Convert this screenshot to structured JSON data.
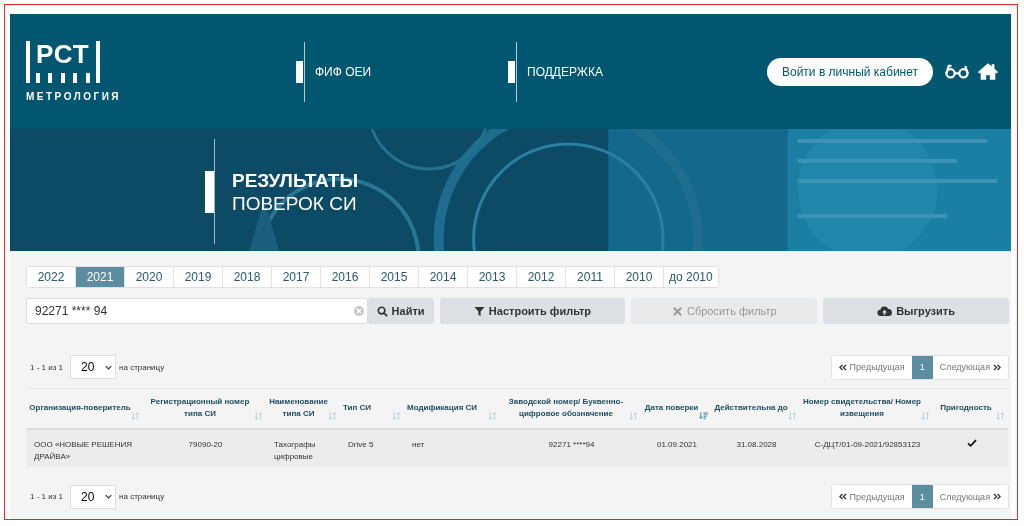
{
  "header": {
    "logo": {
      "mark": "РСТ",
      "subtitle": "МЕТРОЛОГИЯ"
    },
    "nav": [
      {
        "label": "ФИФ ОЕИ"
      },
      {
        "label": "ПОДДЕРЖКА"
      }
    ],
    "login_button": "Войти в личный кабинет"
  },
  "banner": {
    "title_bold": "РЕЗУЛЬТАТЫ",
    "title_light": "ПОВЕРОК СИ"
  },
  "year_tabs": [
    {
      "label": "2022",
      "selected": false
    },
    {
      "label": "2021",
      "selected": true
    },
    {
      "label": "2020",
      "selected": false
    },
    {
      "label": "2019",
      "selected": false
    },
    {
      "label": "2018",
      "selected": false
    },
    {
      "label": "2017",
      "selected": false
    },
    {
      "label": "2016",
      "selected": false
    },
    {
      "label": "2015",
      "selected": false
    },
    {
      "label": "2014",
      "selected": false
    },
    {
      "label": "2013",
      "selected": false
    },
    {
      "label": "2012",
      "selected": false
    },
    {
      "label": "2011",
      "selected": false
    },
    {
      "label": "2010",
      "selected": false
    },
    {
      "label": "до 2010",
      "selected": false
    }
  ],
  "search": {
    "value": "92271 **** 94"
  },
  "actions": [
    {
      "kind": "search",
      "label": "Найти",
      "disabled": false
    },
    {
      "kind": "filter",
      "label": "Настроить фильтр",
      "disabled": false
    },
    {
      "kind": "reset",
      "label": "Сбросить фильтр",
      "disabled": true
    },
    {
      "kind": "export",
      "label": "Выгрузить",
      "disabled": false
    }
  ],
  "pagination_top": {
    "info": "1 - 1 из 1",
    "page_size": "20",
    "page_size_label": "на страницу",
    "prev": "Предыдущая",
    "pages": [
      {
        "label": "1",
        "selected": true
      }
    ],
    "next": "Следующая"
  },
  "table": {
    "columns": [
      {
        "label": "Организация-поверитель",
        "sorted": false
      },
      {
        "label": "Регистрационный номер типа СИ",
        "sorted": false
      },
      {
        "label": "Наименование типа СИ",
        "sorted": false
      },
      {
        "label": "Тип СИ",
        "sorted": false
      },
      {
        "label": "Модификация СИ",
        "sorted": false
      },
      {
        "label": "Заводской номер/ Буквенно-цифровое обозначение",
        "sorted": false
      },
      {
        "label": "Дата поверки",
        "sorted": true
      },
      {
        "label": "Действительна до",
        "sorted": false
      },
      {
        "label": "Номер свидетельства/ Номер извещения",
        "sorted": false
      },
      {
        "label": "Пригодность",
        "sorted": false
      }
    ],
    "rows": [
      {
        "cells": [
          "ООО «НОВЫЕ РЕШЕНИЯ ДРАЙВА»",
          "79090-20",
          "Тахографы цифровые",
          "Drive 5",
          "нет",
          "92271 ****94",
          "01.09.2021",
          "31.08.2028",
          "С-ДЦТ/01-09-2021/92853123"
        ],
        "fit": true
      }
    ]
  },
  "pagination_bottom": {
    "info": "1 - 1 из 1",
    "page_size": "20",
    "page_size_label": "на страницу",
    "prev": "Предыдущая",
    "pages": [
      {
        "label": "1",
        "selected": true
      }
    ],
    "next": "Следующая"
  }
}
